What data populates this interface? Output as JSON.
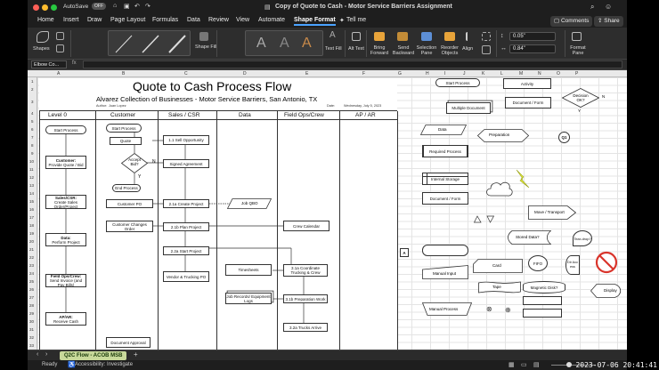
{
  "titlebar": {
    "autosave_label": "AutoSave",
    "autosave_state": "OFF",
    "document_title": "Copy of Quote to Cash - Motor Service Barriers Assignment"
  },
  "tabs": [
    "Home",
    "Insert",
    "Draw",
    "Page Layout",
    "Formulas",
    "Data",
    "Review",
    "View",
    "Automate",
    "Shape Format",
    "Tell me"
  ],
  "active_tab": "Shape Format",
  "comments_label": "Comments",
  "share_label": "Share",
  "ribbon": {
    "shapes_label": "Shapes",
    "shape_fill_label": "Shape Fill",
    "text_fill_label": "Text Fill",
    "alt_text_label": "Alt Text",
    "bring_forward_label": "Bring Forward",
    "send_backward_label": "Send Backward",
    "selection_pane_label": "Selection Pane",
    "reorder_objects_label": "Reorder Objects",
    "align_label": "Align",
    "height_value": "0.05\"",
    "width_value": "0.84\"",
    "format_pane_label": "Format Pane"
  },
  "formula_bar": {
    "name_box": "Elbow Co..."
  },
  "columns": [
    "A",
    "B",
    "C",
    "D",
    "E",
    "F",
    "G",
    "H",
    "I",
    "J",
    "K",
    "L",
    "M",
    "N",
    "O",
    "P"
  ],
  "rows": [
    "1",
    "2",
    "3",
    "4",
    "5",
    "6",
    "7",
    "8",
    "9",
    "10",
    "11",
    "12",
    "13",
    "14",
    "15",
    "16",
    "17",
    "18",
    "19",
    "20",
    "21",
    "22",
    "23",
    "24",
    "25",
    "26",
    "27",
    "28",
    "29",
    "30",
    "31",
    "32",
    "33",
    "34",
    "35"
  ],
  "flow": {
    "title": "Quote to Cash Process Flow",
    "subtitle": "Alvarez Collection of Businesses - Motor Service Barriers, San Antonio, TX",
    "author_label": "Author:",
    "author": "Juan Lopez",
    "date_label": "Date:",
    "date": "Wednesday, July 5, 2023",
    "lanes": [
      "Level 0",
      "Customer",
      "Sales / CSR",
      "Data",
      "Field Ops/Crew",
      "AP / AR"
    ],
    "level0": {
      "start": "Start Process",
      "customer": "Customer:",
      "customer_sub": "Provide Quote / Bid",
      "sales": "Sales/CSR:",
      "sales_sub": "Create Sales Order/Project",
      "data": "Data:",
      "data_sub": "Perform Project",
      "field": "Field Ops/Crew:",
      "field_sub": "Send Invoice (and Pay Bills)",
      "apar": "AP/AR:",
      "apar_sub": "Receive Cash"
    },
    "nodes": {
      "start_process": "Start Process",
      "quote": "Quote",
      "sell_opportunity": "1.1 Sell Opportunity",
      "accept_bid": "Accept Bid?",
      "n_label": "N",
      "y_label": "Y",
      "end_process": "End Process",
      "signed_agreement": "Signed Agreement",
      "customer_po": "Customer PO",
      "create_project": "2.1a Create Project",
      "job_qbo": "Job QBO",
      "customer_changes": "Customer Changes Order",
      "plan_project": "2.1b Plan Project",
      "crew_calendar": "Crew Calendar",
      "start_project": "2.2a Start Project",
      "vendor_po": "Vendor & Trucking PO",
      "timesheets": "Timesheets",
      "coordinate_trucking": "3.1a Coordinate Trucking & Crew",
      "job_records": "Job Records/ Equipment Logs",
      "preparation_work": "3.1b Preparation Work",
      "trucks_arrive": "3.2a Trucks Arrive",
      "document_approval": "Document Approval"
    },
    "legend": {
      "start_process": "Start Process",
      "activity": "Activity",
      "decision": "Decision OK?",
      "y_label": "Y",
      "n_label": "N",
      "multiple_document": "Multiple Document",
      "document_form": "Document / Form",
      "data": "Data",
      "preparation": "Preparation",
      "connector": "Q1",
      "required_process": "Required Process",
      "internal_storage": "Internal Storage",
      "document_form2": "Document / Form",
      "move_transport": "Move / Transport",
      "stored_data": "Stored Data?",
      "teardrop": "Tear-drop?",
      "a_label": "A",
      "card": "Card",
      "fifo": "FIFO",
      "direct_access": "Dir Acc ess",
      "manual_input": "Manual Input",
      "tape": "Tape",
      "magnetic_disk": "Magnetic Disk?",
      "display": "Display",
      "manual_process": "Manual Process"
    }
  },
  "sheet_tab": "Q2C Flow - ACOB MSB",
  "status": {
    "ready": "Ready",
    "accessibility": "Accessibility: Investigate"
  },
  "clock": "2023-07-06  20:41:41",
  "colors": {
    "ribbon_bg": "#2d2d2d",
    "active_tab_underline": "#4aa3ff",
    "sheet_tab_bg": "#c8d99a"
  }
}
